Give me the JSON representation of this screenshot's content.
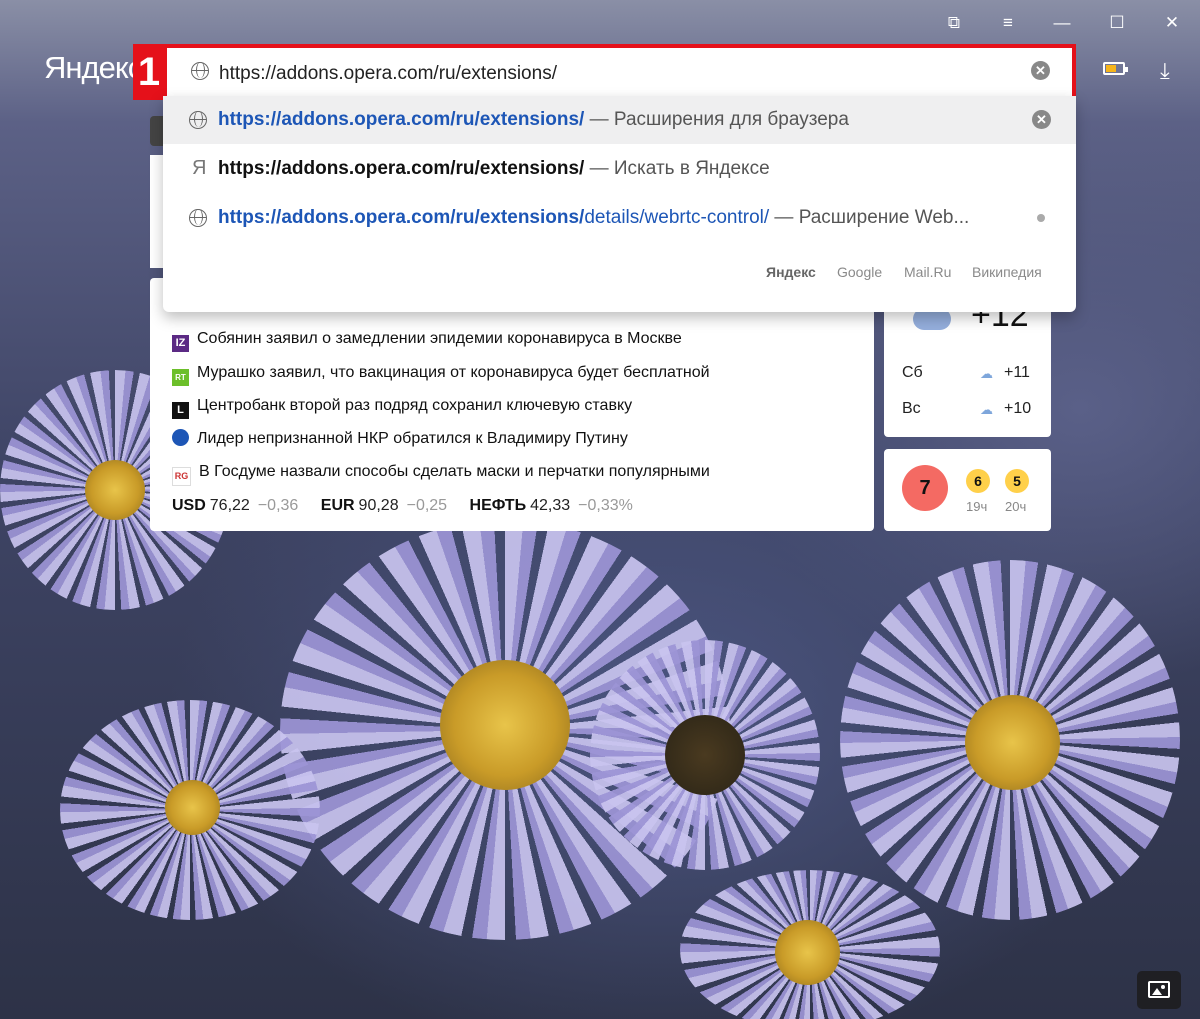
{
  "header": {
    "logo": "Яндекс",
    "step_badge": "1",
    "address_value": "https://addons.opera.com/ru/extensions/"
  },
  "suggestions": [
    {
      "url": "https://addons.opera.com/ru/extensions/",
      "rest": "",
      "desc": "— Расширения для браузера",
      "icon": "globe-icon"
    },
    {
      "url": "https://addons.opera.com/ru/extensions/",
      "rest": "",
      "desc": "— Искать в Яндексе",
      "icon": "yandex-icon"
    },
    {
      "url": "https://addons.opera.com/ru/extensions/",
      "rest": "details/webrtc-control/",
      "desc": "— Расширение Web...",
      "icon": "globe-icon"
    }
  ],
  "search_engines": [
    "Яндекс",
    "Google",
    "Mail.Ru",
    "Википедия"
  ],
  "news": [
    {
      "source": "IZ",
      "text": "Собянин заявил о замедлении эпидемии коронавируса в Москве"
    },
    {
      "source": "RT",
      "text": "Мурашко заявил, что вакцинация от коронавируса будет бесплатной"
    },
    {
      "source": "L",
      "text": "Центробанк второй раз подряд сохранил ключевую ставку"
    },
    {
      "source": "",
      "text": "Лидер непризнанной НКР обратился к Владимиру Путину"
    },
    {
      "source": "RG",
      "text": "В Госдуме назвали способы сделать маски и перчатки популярными"
    }
  ],
  "rates": [
    {
      "name": "USD",
      "value": "76,22",
      "delta": "−0,36"
    },
    {
      "name": "EUR",
      "value": "90,28",
      "delta": "−0,25"
    },
    {
      "name": "НЕФТЬ",
      "value": "42,33",
      "delta": "−0,33%"
    }
  ],
  "weather": {
    "now": "+12",
    "days": [
      {
        "day": "Сб",
        "temp": "+11"
      },
      {
        "day": "Вс",
        "temp": "+10"
      }
    ]
  },
  "traffic": {
    "now": "7",
    "forecast": [
      {
        "score": "6",
        "time": "19ч"
      },
      {
        "score": "5",
        "time": "20ч"
      }
    ]
  },
  "colors": {
    "accent_red": "#e5111a",
    "link_blue": "#1d56b6",
    "traffic_red": "#f46a63",
    "traffic_yellow": "#ffd04a"
  }
}
